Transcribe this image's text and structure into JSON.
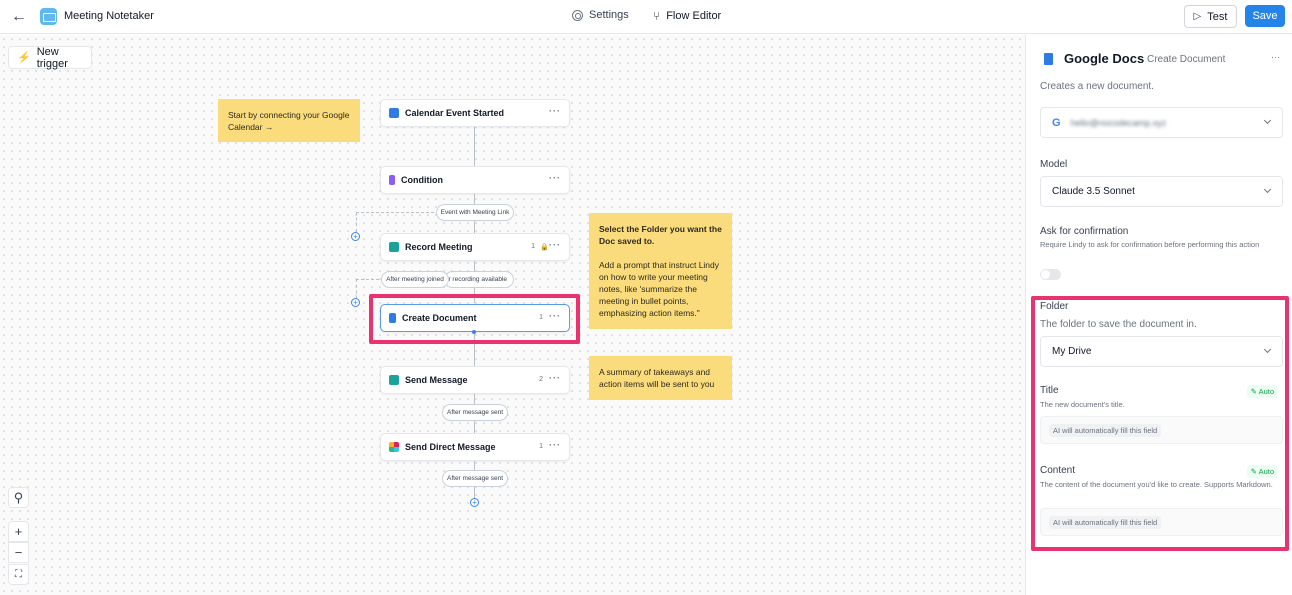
{
  "topbar": {
    "back_icon": "arrow-left-icon",
    "app_title": "Meeting Notetaker",
    "settings_label": "Settings",
    "flow_editor_label": "Flow Editor",
    "test_label": "Test",
    "save_label": "Save"
  },
  "canvas": {
    "new_trigger_label": "New trigger",
    "stickies": [
      "Start by connecting your Google Calendar →",
      "Select the Folder you want the Doc saved to.",
      "Add a prompt that instruct Lindy on how to write your meeting notes, like 'summarize the meeting in bullet points, emphasizing action items.\"",
      "A summary of takeaways and action items will be sent to you"
    ],
    "nodes": [
      {
        "label": "Calendar Event Started",
        "count": "",
        "icon": "calendar-icon",
        "color": "#2f7be5"
      },
      {
        "label": "Condition",
        "count": "",
        "icon": "branch-icon",
        "color": "#8b5cf6"
      },
      {
        "label": "Record Meeting",
        "count": "1",
        "icon": "video-icon",
        "color": "#1aa39a"
      },
      {
        "label": "Create Document",
        "count": "1",
        "icon": "doc-icon",
        "color": "#2f7be5"
      },
      {
        "label": "Send Message",
        "count": "2",
        "icon": "message-icon",
        "color": "#1aa39a"
      },
      {
        "label": "Send Direct Message",
        "count": "1",
        "icon": "slack-icon",
        "color": "#e01e5a"
      }
    ],
    "pills": {
      "event_with_link": "Event with Meeting Link",
      "after_meeting_joined": "After meeting joined",
      "after_recording": "er recording available",
      "after_message_sent_1": "After message sent",
      "after_message_sent_2": "After message sent"
    }
  },
  "panel": {
    "title": "Google Docs",
    "subtitle": "Create Document",
    "description": "Creates a new document.",
    "account_email": "hello@nocodecamp.xyz",
    "model_label": "Model",
    "model_value": "Claude 3.5 Sonnet",
    "confirm_label": "Ask for confirmation",
    "confirm_desc": "Require Lindy to ask for confirmation before performing this action",
    "confirm_enabled": false,
    "folder_label": "Folder",
    "folder_desc": "The folder to save the document in.",
    "folder_value": "My Drive",
    "title_label": "Title",
    "title_desc": "The new document's title.",
    "title_auto": "Auto",
    "title_ai": "AI will automatically fill this field",
    "content_label": "Content",
    "content_desc": "The content of the document you'd like to create. Supports Markdown.",
    "content_auto": "Auto",
    "content_ai": "AI will automatically fill this field"
  },
  "colors": {
    "accent": "#2584e8",
    "highlight": "#e8336e",
    "sticky": "#fbdc7c"
  }
}
